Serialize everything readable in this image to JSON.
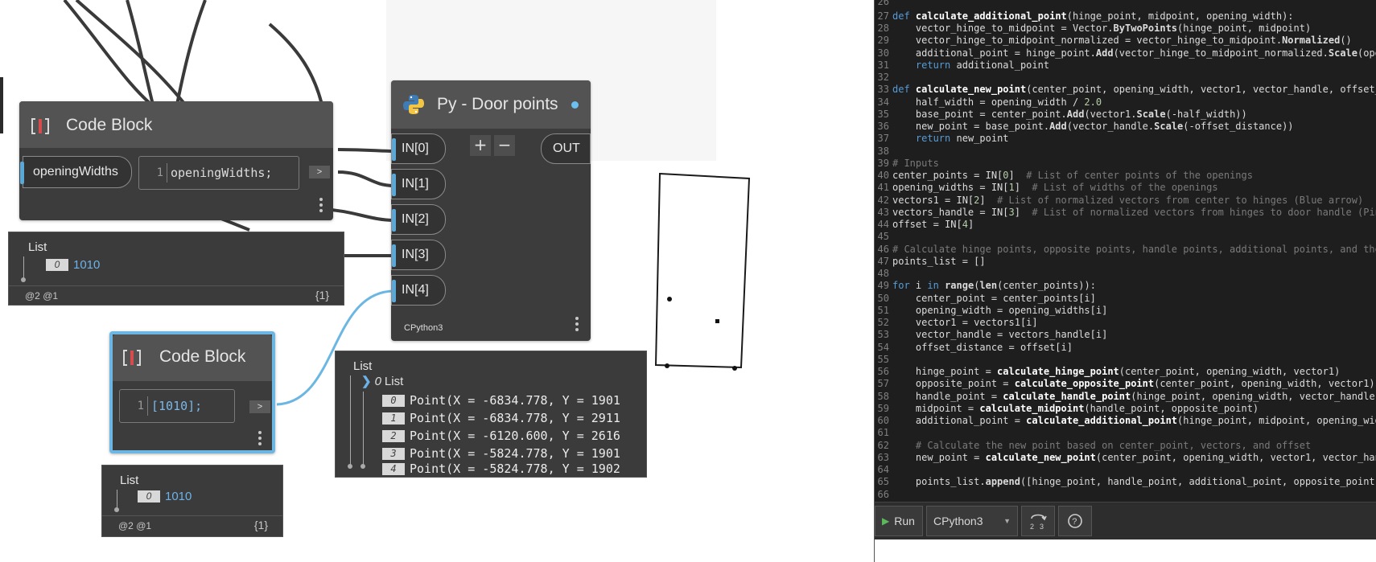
{
  "canvas": {
    "code_block_1": {
      "title": "Code Block",
      "input_label": "openingWidths",
      "line_number": "1",
      "code": "openingWidths;",
      "out_arrow": ">"
    },
    "preview_1": {
      "title": "List",
      "index": "0",
      "value": "1010",
      "footer_left": "@2 @1",
      "footer_right": "{1}"
    },
    "python_node": {
      "title": "Py - Door points",
      "inputs": [
        "IN[0]",
        "IN[1]",
        "IN[2]",
        "IN[3]",
        "IN[4]"
      ],
      "add_label": "+",
      "remove_label": "−",
      "output": "OUT",
      "engine": "CPython3"
    },
    "code_block_2": {
      "title": "Code Block",
      "line_number": "1",
      "code": "[1010];",
      "out_arrow": ">"
    },
    "preview_2": {
      "title": "List",
      "index": "0",
      "value": "1010",
      "footer_left": "@2 @1",
      "footer_right": "{1}"
    },
    "preview_3": {
      "title": "List",
      "sublist_index": "0",
      "sublist_label": "List",
      "points": [
        {
          "index": "0",
          "text": "Point(X = -6834.778, Y = 1901"
        },
        {
          "index": "1",
          "text": "Point(X = -6834.778, Y = 2911"
        },
        {
          "index": "2",
          "text": "Point(X = -6120.600, Y = 2616"
        },
        {
          "index": "3",
          "text": "Point(X = -5824.778, Y = 1901"
        },
        {
          "index": "4",
          "text": "Point(X = -5824.778, Y = 1902"
        }
      ]
    }
  },
  "editor": {
    "run_label": "Run",
    "engine_label": "CPython3",
    "colors": {
      "background": "#1e1e1e",
      "keyword": "#569cd6",
      "comment": "#7a7a7a",
      "number": "#b5cea8"
    }
  }
}
